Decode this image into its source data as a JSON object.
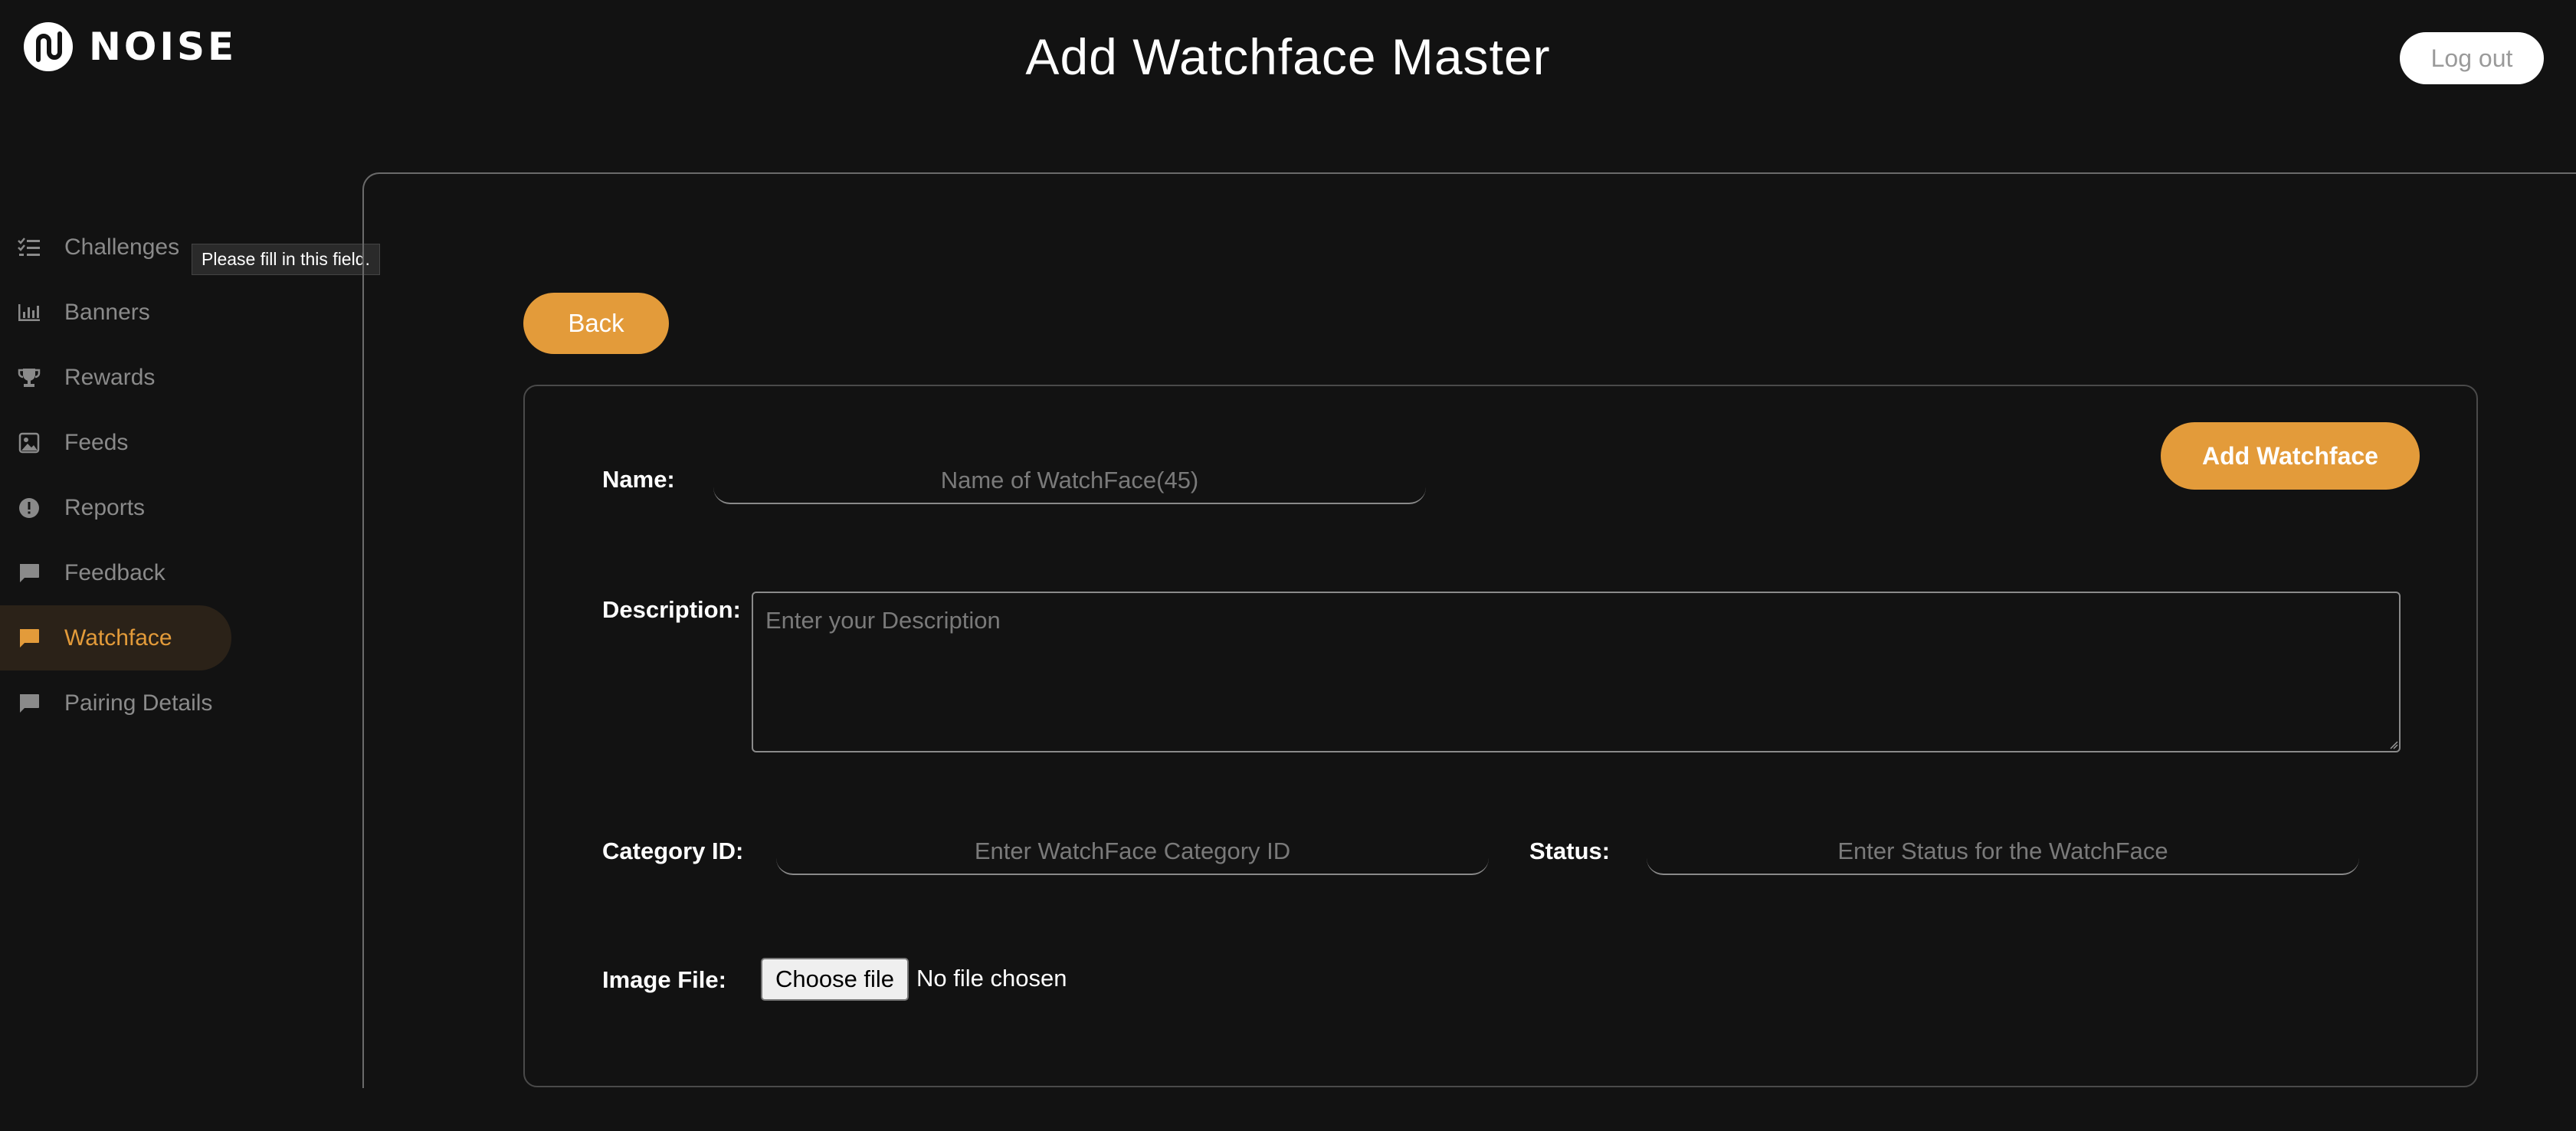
{
  "header": {
    "logo_text": "NOISE",
    "title": "Add Watchface Master",
    "logout_label": "Log out"
  },
  "sidebar": {
    "items": [
      {
        "label": "Challenges",
        "icon": "checklist-icon"
      },
      {
        "label": "Banners",
        "icon": "bar-chart-icon"
      },
      {
        "label": "Rewards",
        "icon": "trophy-icon"
      },
      {
        "label": "Feeds",
        "icon": "image-icon"
      },
      {
        "label": "Reports",
        "icon": "alert-icon"
      },
      {
        "label": "Feedback",
        "icon": "chat-icon"
      },
      {
        "label": "Watchface",
        "icon": "chat-icon",
        "active": true
      },
      {
        "label": "Pairing Details",
        "icon": "chat-icon"
      }
    ],
    "accent_color": "#e39b3a"
  },
  "tooltip": {
    "text": "Please fill in this field."
  },
  "form": {
    "back_label": "Back",
    "submit_label": "Add Watchface",
    "name_label": "Name:",
    "name_placeholder": "Name of WatchFace(45)",
    "description_label": "Description:",
    "description_placeholder": "Enter your Description",
    "category_label": "Category ID:",
    "category_placeholder": "Enter WatchFace Category ID",
    "status_label": "Status:",
    "status_placeholder": "Enter Status for the WatchFace",
    "image_label": "Image File:",
    "choose_file_label": "Choose file",
    "file_status": "No file chosen"
  }
}
